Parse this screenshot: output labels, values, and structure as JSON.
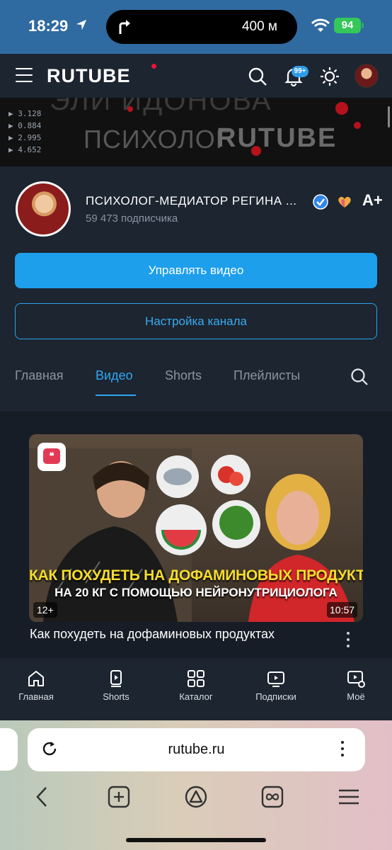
{
  "status_bar": {
    "time": "18:29",
    "navigation_distance": "400 м",
    "battery": "94"
  },
  "header": {
    "logo": "RUTUBE",
    "notification_badge": "99+",
    "icons": [
      "menu-icon",
      "search-icon",
      "bell-icon",
      "sun-icon",
      "avatar"
    ]
  },
  "banner": {
    "top_text": "ЭЛИ ИДОНОВА",
    "left_text": "ПСИХОЛОГ",
    "right_text": "RUTUBE",
    "stats": [
      "3.128",
      "0.884",
      "2.995",
      "4.652"
    ]
  },
  "channel": {
    "name": "ПСИХОЛОГ-МЕДИАТОР РЕГИНА ...",
    "subscribers": "59 473 подписчика",
    "manage_button": "Управлять видео",
    "settings_button": "Настройка канала",
    "add_label": "A+"
  },
  "tabs": {
    "items": [
      "Главная",
      "Видео",
      "Shorts",
      "Плейлисты"
    ],
    "active": "Видео"
  },
  "video": {
    "thumb_title_line1": "КАК ПОХУДЕТЬ НА ДОФАМИНОВЫХ ПРОДУКТАХ",
    "thumb_title_line2": "НА 20 КГ С ПОМОЩЬЮ НЕЙРОНУТРИЦИОЛОГА",
    "age_rating": "12+",
    "duration": "10:57",
    "title": "Как похудеть на дофаминовых продуктах"
  },
  "bottom_nav": {
    "items": [
      {
        "label": "Главная",
        "icon": "home-icon"
      },
      {
        "label": "Shorts",
        "icon": "shorts-icon"
      },
      {
        "label": "Каталог",
        "icon": "catalog-icon"
      },
      {
        "label": "Подписки",
        "icon": "subscriptions-icon"
      },
      {
        "label": "Моё",
        "icon": "my-icon"
      }
    ]
  },
  "browser": {
    "url": "rutube.ru",
    "toolbar_icons": [
      "back-icon",
      "new-tab-icon",
      "alice-icon",
      "tabs-icon",
      "menu-icon"
    ]
  },
  "colors": {
    "accent": "#1d9fec",
    "background": "#1c2530",
    "status_bar": "#2f6aa0",
    "logo_dot": "#ed143b",
    "thumb_title": "#f6dd2c",
    "battery": "#34c759"
  }
}
